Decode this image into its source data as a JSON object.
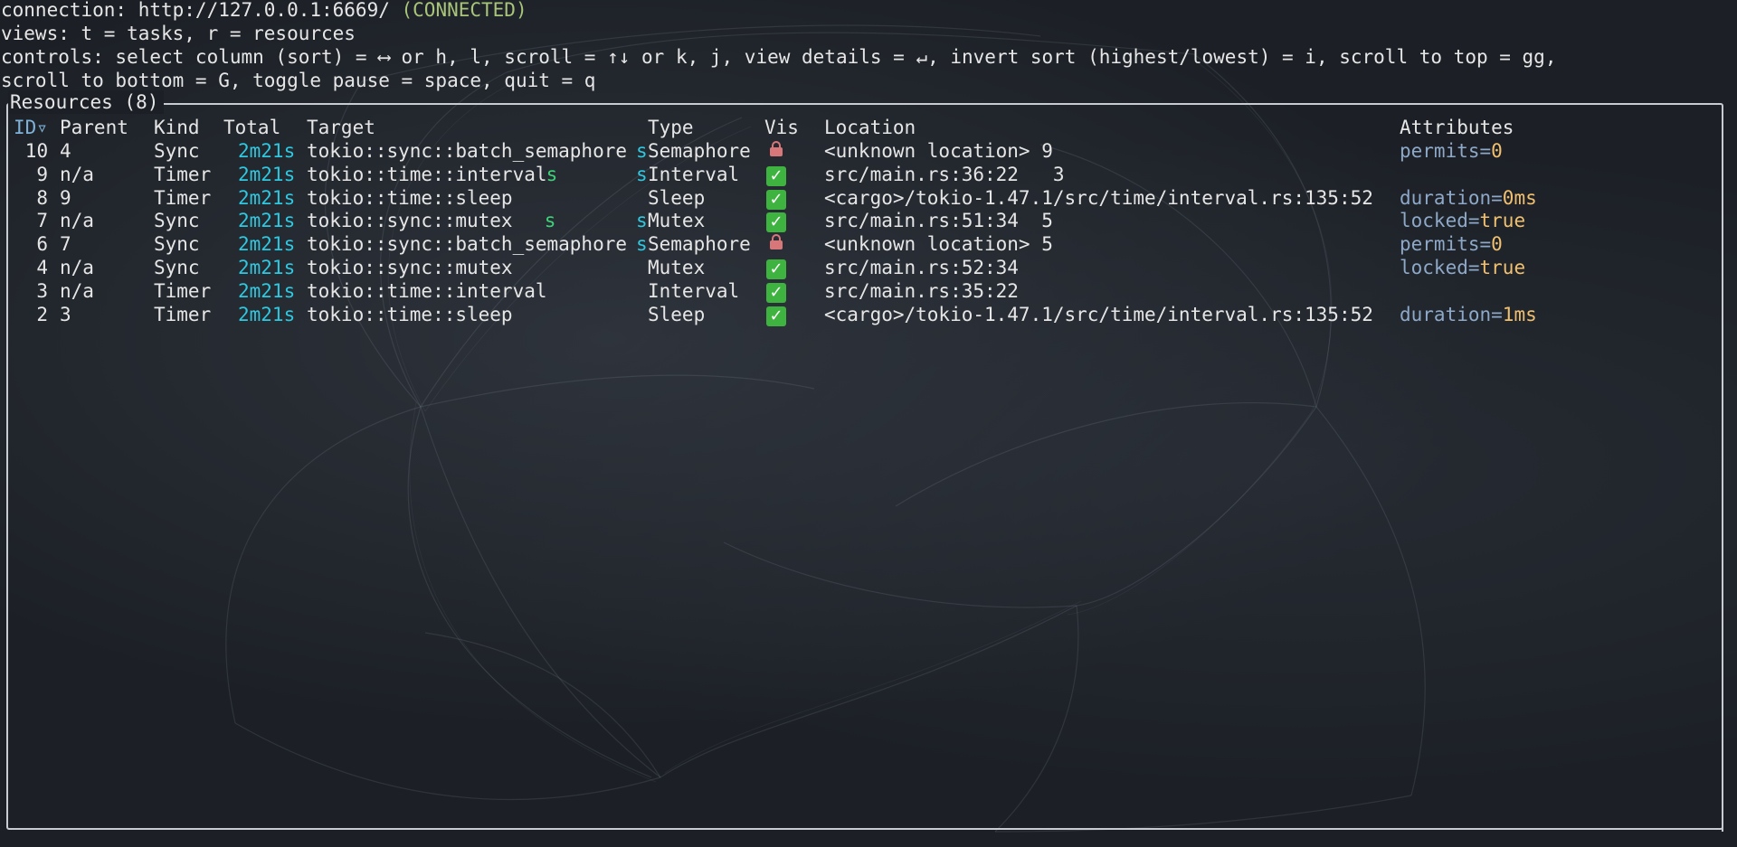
{
  "header": {
    "connection_label": "connection: http://127.0.0.1:6669/ ",
    "connection_status": "(CONNECTED)",
    "views_line": "views: t = tasks, r = resources",
    "controls_line_1": "controls: select column (sort) = ⟷ or h, l, scroll = ↑↓ or k, j, view details = ↵, invert sort (highest/lowest) = i, scroll to top = gg,",
    "controls_line_2": "scroll to bottom = G, toggle pause = space, quit = q"
  },
  "panel": {
    "title": "Resources (8)"
  },
  "columns": {
    "id": "ID▿",
    "parent": "Parent",
    "kind": "Kind",
    "total": "Total",
    "target": "Target",
    "type": "Type",
    "vis": "Vis",
    "location": "Location",
    "attributes": "Attributes"
  },
  "rows": [
    {
      "id": "10",
      "parent": "4",
      "kind": "Sync",
      "total": "2m21s",
      "target": "tokio::sync::batch_semaphore",
      "target_mid": "",
      "target_end": "s",
      "type": "Semaphore",
      "vis": "lock",
      "location": "<unknown location> 9",
      "attr_key": "permits=",
      "attr_val": "0"
    },
    {
      "id": "9",
      "parent": "n/a",
      "kind": "Timer",
      "total": "2m21s",
      "target": "tokio::time::interval",
      "target_mid": "s",
      "target_end": "s",
      "type": "Interval",
      "vis": "check",
      "location": "src/main.rs:36:22   3",
      "attr_key": "",
      "attr_val": ""
    },
    {
      "id": "8",
      "parent": "9",
      "kind": "Timer",
      "total": "2m21s",
      "target": "tokio::time::sleep",
      "target_mid": "",
      "target_end": "",
      "type": "Sleep",
      "vis": "check",
      "location": "<cargo>/tokio-1.47.1/src/time/interval.rs:135:52",
      "attr_key": "duration=",
      "attr_val": "0ms"
    },
    {
      "id": "7",
      "parent": "n/a",
      "kind": "Sync",
      "total": "2m21s",
      "target": "tokio::sync::mutex",
      "target_mid": "s",
      "target_end": "s",
      "type": "Mutex",
      "vis": "check",
      "location": "src/main.rs:51:34  5",
      "attr_key": "locked=",
      "attr_val": "true"
    },
    {
      "id": "6",
      "parent": "7",
      "kind": "Sync",
      "total": "2m21s",
      "target": "tokio::sync::batch_semaphore",
      "target_mid": "",
      "target_end": "s",
      "type": "Semaphore",
      "vis": "lock",
      "location": "<unknown location> 5",
      "attr_key": "permits=",
      "attr_val": "0"
    },
    {
      "id": "4",
      "parent": "n/a",
      "kind": "Sync",
      "total": "2m21s",
      "target": "tokio::sync::mutex",
      "target_mid": "",
      "target_end": "",
      "type": "Mutex",
      "vis": "check",
      "location": "src/main.rs:52:34",
      "attr_key": "locked=",
      "attr_val": "true"
    },
    {
      "id": "3",
      "parent": "n/a",
      "kind": "Timer",
      "total": "2m21s",
      "target": "tokio::time::interval",
      "target_mid": "",
      "target_end": "",
      "type": "Interval",
      "vis": "check",
      "location": "src/main.rs:35:22",
      "attr_key": "",
      "attr_val": ""
    },
    {
      "id": "2",
      "parent": "3",
      "kind": "Timer",
      "total": "2m21s",
      "target": "tokio::time::sleep",
      "target_mid": "",
      "target_end": "",
      "type": "Sleep",
      "vis": "check",
      "location": "<cargo>/tokio-1.47.1/src/time/interval.rs:135:52",
      "attr_key": "duration=",
      "attr_val": "1ms"
    }
  ],
  "colors": {
    "background": "#1c2026",
    "text": "#e6e6e6",
    "connected": "#a8c57a",
    "duration": "#2ec8e0",
    "attr_key": "#8ea8c8",
    "attr_val": "#f0c070",
    "vis_check": "#3fb33f",
    "vis_lock": "#d8777a"
  },
  "icons": {
    "vis_check": "check-mark-icon",
    "vis_lock": "lock-icon"
  }
}
